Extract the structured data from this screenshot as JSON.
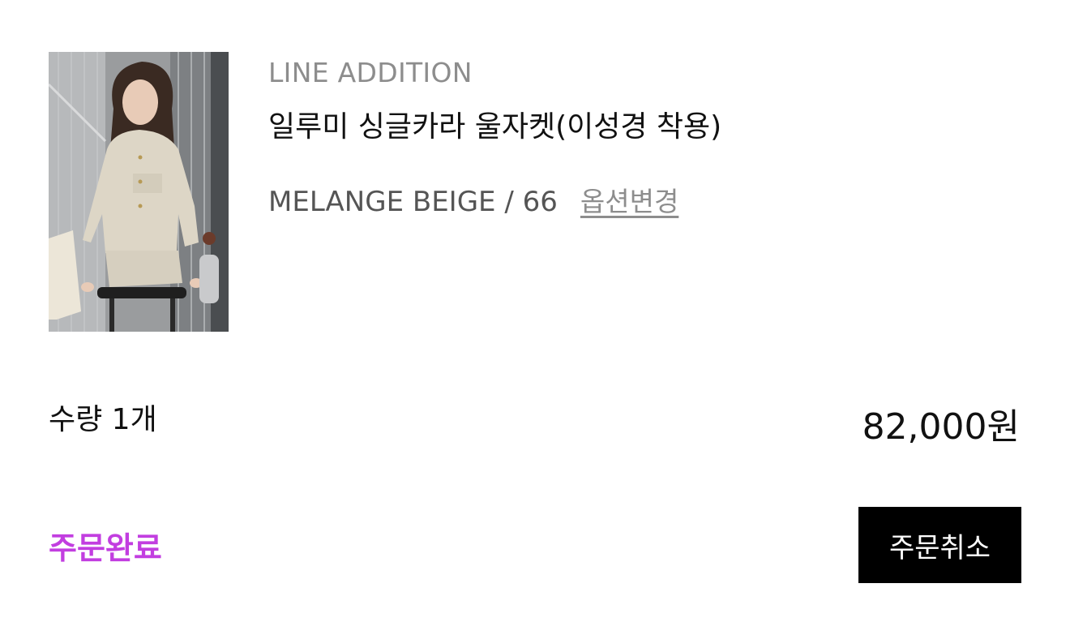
{
  "product": {
    "brand": "LINE ADDITION",
    "name": "일루미 싱글카라 울자켓(이성경 착용)",
    "option": "MELANGE BEIGE / 66",
    "option_change_label": "옵션변경",
    "image_icon": "product-photo"
  },
  "order": {
    "quantity_label": "수량 1개",
    "price": "82,000원",
    "status": "주문완료",
    "cancel_label": "주문취소"
  },
  "colors": {
    "status": "#c23ee0",
    "button_bg": "#000000",
    "brand_gray": "#8d8d8d"
  }
}
